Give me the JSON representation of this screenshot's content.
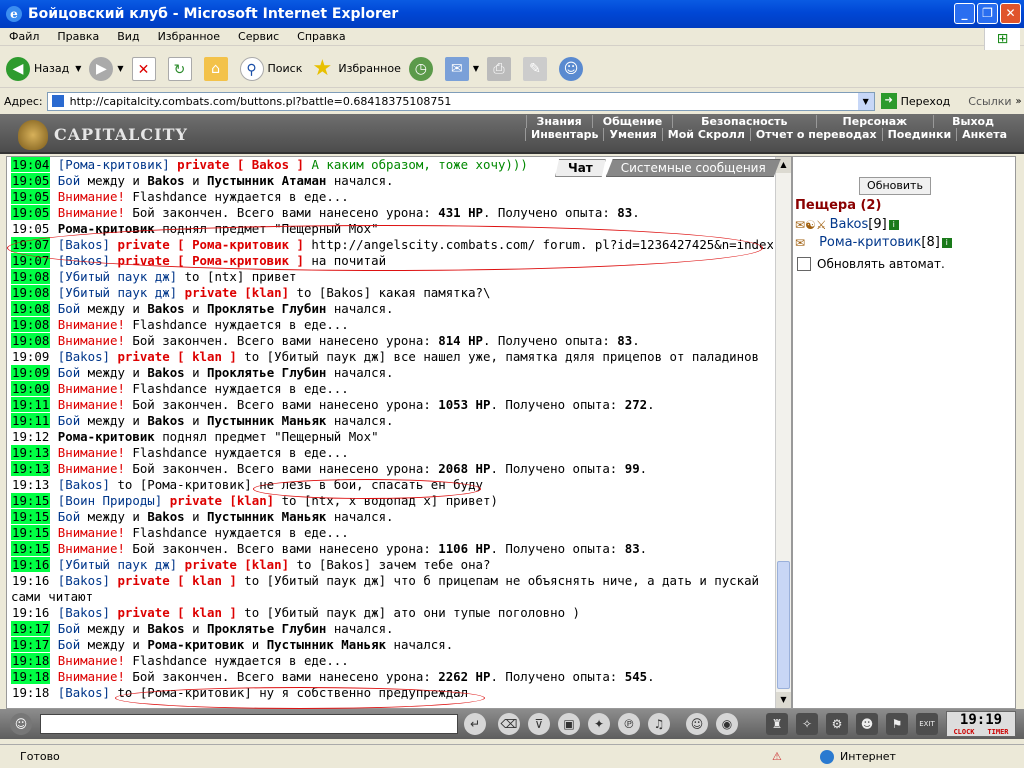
{
  "window": {
    "title": "Бойцовский клуб - Microsoft Internet Explorer"
  },
  "menu": [
    "Файл",
    "Правка",
    "Вид",
    "Избранное",
    "Сервис",
    "Справка"
  ],
  "toolbar": {
    "back": "Назад",
    "search": "Поиск",
    "favorites": "Избранное"
  },
  "address": {
    "label": "Адрес:",
    "url": "http://capitalcity.combats.com/buttons.pl?battle=0.68418375108751",
    "go": "Переход",
    "links": "Ссылки"
  },
  "game": {
    "logo": "CAPITALCITY",
    "nav1": [
      "Знания",
      "Общение",
      "Безопасность",
      "Персонаж",
      "Выход"
    ],
    "nav2": [
      "Инвентарь",
      "Умения",
      "Мой Скролл",
      "Отчет о переводах",
      "Поединки",
      "Анкета"
    ]
  },
  "tabs": {
    "chat": "Чат",
    "system": "Системные сообщения"
  },
  "chat_lines": [
    {
      "ts": "19:04",
      "hl": true,
      "parts": [
        {
          "t": "[Рома-критовик]",
          "c": "nick"
        },
        {
          "t": " "
        },
        {
          "t": "private [ Bakos ]",
          "c": "priv"
        },
        {
          "t": " А каким образом, тоже хочу)))",
          "c": "grn"
        }
      ]
    },
    {
      "ts": "19:05",
      "hl": true,
      "parts": [
        {
          "t": "Бой",
          "c": "nick"
        },
        {
          "t": " между и "
        },
        {
          "t": "Bakos",
          "c": "b"
        },
        {
          "t": " и "
        },
        {
          "t": "Пустынник Атаман",
          "c": "b"
        },
        {
          "t": " начался."
        }
      ]
    },
    {
      "ts": "19:05",
      "hl": true,
      "parts": [
        {
          "t": "Внимание!",
          "c": "warn"
        },
        {
          "t": " Flashdance нуждается в еде..."
        }
      ]
    },
    {
      "ts": "19:05",
      "hl": true,
      "parts": [
        {
          "t": "Внимание!",
          "c": "warn"
        },
        {
          "t": " Бой закончен. Всего вами нанесено урона: "
        },
        {
          "t": "431 HP",
          "c": "b"
        },
        {
          "t": ". Получено опыта: "
        },
        {
          "t": "83",
          "c": "b"
        },
        {
          "t": "."
        }
      ]
    },
    {
      "ts": "19:05",
      "hl": false,
      "parts": [
        {
          "t": "Рома-критовик",
          "c": "b"
        },
        {
          "t": " поднял предмет \"Пещерный Мох\""
        }
      ]
    },
    {
      "ts": "19:07",
      "hl": true,
      "parts": [
        {
          "t": "[Bakos]",
          "c": "nick"
        },
        {
          "t": " "
        },
        {
          "t": "private [ Рома-критовик ]",
          "c": "priv"
        },
        {
          "t": " http://angelscity.combats.com/ forum. pl?id=1236427425&n=index"
        }
      ]
    },
    {
      "ts": "19:07",
      "hl": true,
      "parts": [
        {
          "t": "[Bakos]",
          "c": "nick"
        },
        {
          "t": " "
        },
        {
          "t": "private [ Рома-критовик ]",
          "c": "priv"
        },
        {
          "t": " на почитай"
        }
      ]
    },
    {
      "ts": "19:08",
      "hl": true,
      "parts": [
        {
          "t": "[Убитый паук дж]",
          "c": "nick"
        },
        {
          "t": " to [ntx] привет"
        }
      ]
    },
    {
      "ts": "19:08",
      "hl": true,
      "parts": [
        {
          "t": "[Убитый паук дж]",
          "c": "nick"
        },
        {
          "t": " "
        },
        {
          "t": "private [klan]",
          "c": "priv"
        },
        {
          "t": " to [Bakos] какая памятка?\\"
        }
      ]
    },
    {
      "ts": "19:08",
      "hl": true,
      "parts": [
        {
          "t": "Бой",
          "c": "nick"
        },
        {
          "t": " между и "
        },
        {
          "t": "Bakos",
          "c": "b"
        },
        {
          "t": " и "
        },
        {
          "t": "Проклятье Глубин",
          "c": "b"
        },
        {
          "t": " начался."
        }
      ]
    },
    {
      "ts": "19:08",
      "hl": true,
      "parts": [
        {
          "t": "Внимание!",
          "c": "warn"
        },
        {
          "t": " Flashdance нуждается в еде..."
        }
      ]
    },
    {
      "ts": "19:08",
      "hl": true,
      "parts": [
        {
          "t": "Внимание!",
          "c": "warn"
        },
        {
          "t": " Бой закончен. Всего вами нанесено урона: "
        },
        {
          "t": "814 HP",
          "c": "b"
        },
        {
          "t": ". Получено опыта: "
        },
        {
          "t": "83",
          "c": "b"
        },
        {
          "t": "."
        }
      ]
    },
    {
      "ts": "19:09",
      "hl": false,
      "parts": [
        {
          "t": "[Bakos]",
          "c": "nick"
        },
        {
          "t": " "
        },
        {
          "t": "private [ klan ]",
          "c": "priv"
        },
        {
          "t": " to [Убитый паук дж] все нашел уже, памятка дяля прицепов от паладинов"
        }
      ]
    },
    {
      "ts": "19:09",
      "hl": true,
      "parts": [
        {
          "t": "Бой",
          "c": "nick"
        },
        {
          "t": " между и "
        },
        {
          "t": "Bakos",
          "c": "b"
        },
        {
          "t": " и "
        },
        {
          "t": "Проклятье Глубин",
          "c": "b"
        },
        {
          "t": " начался."
        }
      ]
    },
    {
      "ts": "19:09",
      "hl": true,
      "parts": [
        {
          "t": "Внимание!",
          "c": "warn"
        },
        {
          "t": " Flashdance нуждается в еде..."
        }
      ]
    },
    {
      "ts": "19:11",
      "hl": true,
      "parts": [
        {
          "t": "Внимание!",
          "c": "warn"
        },
        {
          "t": " Бой закончен. Всего вами нанесено урона: "
        },
        {
          "t": "1053 HP",
          "c": "b"
        },
        {
          "t": ". Получено опыта: "
        },
        {
          "t": "272",
          "c": "b"
        },
        {
          "t": "."
        }
      ]
    },
    {
      "ts": "19:11",
      "hl": true,
      "parts": [
        {
          "t": "Бой",
          "c": "nick"
        },
        {
          "t": " между и "
        },
        {
          "t": "Bakos",
          "c": "b"
        },
        {
          "t": " и "
        },
        {
          "t": "Пустынник Маньяк",
          "c": "b"
        },
        {
          "t": " начался."
        }
      ]
    },
    {
      "ts": "19:12",
      "hl": false,
      "parts": [
        {
          "t": "Рома-критовик",
          "c": "b"
        },
        {
          "t": " поднял предмет \"Пещерный Мох\""
        }
      ]
    },
    {
      "ts": "19:13",
      "hl": true,
      "parts": [
        {
          "t": "Внимание!",
          "c": "warn"
        },
        {
          "t": " Flashdance нуждается в еде..."
        }
      ]
    },
    {
      "ts": "19:13",
      "hl": true,
      "parts": [
        {
          "t": "Внимание!",
          "c": "warn"
        },
        {
          "t": " Бой закончен. Всего вами нанесено урона: "
        },
        {
          "t": "2068 HP",
          "c": "b"
        },
        {
          "t": ". Получено опыта: "
        },
        {
          "t": "99",
          "c": "b"
        },
        {
          "t": "."
        }
      ]
    },
    {
      "ts": "19:13",
      "hl": false,
      "parts": [
        {
          "t": "[Bakos]",
          "c": "nick"
        },
        {
          "t": " to [Рома-критовик] не лезь в бои, спасать ен буду"
        }
      ]
    },
    {
      "ts": "19:15",
      "hl": true,
      "parts": [
        {
          "t": "[Воин Природы]",
          "c": "nick"
        },
        {
          "t": " "
        },
        {
          "t": "private [klan]",
          "c": "priv"
        },
        {
          "t": " to [ntx, x водопад x] привет)"
        }
      ]
    },
    {
      "ts": "19:15",
      "hl": true,
      "parts": [
        {
          "t": "Бой",
          "c": "nick"
        },
        {
          "t": " между и "
        },
        {
          "t": "Bakos",
          "c": "b"
        },
        {
          "t": " и "
        },
        {
          "t": "Пустынник Маньяк",
          "c": "b"
        },
        {
          "t": " начался."
        }
      ]
    },
    {
      "ts": "19:15",
      "hl": true,
      "parts": [
        {
          "t": "Внимание!",
          "c": "warn"
        },
        {
          "t": " Flashdance нуждается в еде..."
        }
      ]
    },
    {
      "ts": "19:15",
      "hl": true,
      "parts": [
        {
          "t": "Внимание!",
          "c": "warn"
        },
        {
          "t": " Бой закончен. Всего вами нанесено урона: "
        },
        {
          "t": "1106 HP",
          "c": "b"
        },
        {
          "t": ". Получено опыта: "
        },
        {
          "t": "83",
          "c": "b"
        },
        {
          "t": "."
        }
      ]
    },
    {
      "ts": "19:16",
      "hl": true,
      "parts": [
        {
          "t": "[Убитый паук дж]",
          "c": "nick"
        },
        {
          "t": " "
        },
        {
          "t": "private [klan]",
          "c": "priv"
        },
        {
          "t": " to [Bakos] зачем тебе она?"
        }
      ]
    },
    {
      "ts": "19:16",
      "hl": false,
      "wrap": true,
      "parts": [
        {
          "t": "[Bakos]",
          "c": "nick"
        },
        {
          "t": " "
        },
        {
          "t": "private [ klan ]",
          "c": "priv"
        },
        {
          "t": " to [Убитый паук дж] что б прицепам не объяснять ниче, а дать и пускай сами читают"
        }
      ]
    },
    {
      "ts": "19:16",
      "hl": false,
      "parts": [
        {
          "t": "[Bakos]",
          "c": "nick"
        },
        {
          "t": " "
        },
        {
          "t": "private [ klan ]",
          "c": "priv"
        },
        {
          "t": " to [Убитый паук дж] ато они тупые поголовно )"
        }
      ]
    },
    {
      "ts": "19:17",
      "hl": true,
      "parts": [
        {
          "t": "Бой",
          "c": "nick"
        },
        {
          "t": " между и "
        },
        {
          "t": "Bakos",
          "c": "b"
        },
        {
          "t": " и "
        },
        {
          "t": "Проклятье Глубин",
          "c": "b"
        },
        {
          "t": " начался."
        }
      ]
    },
    {
      "ts": "19:17",
      "hl": true,
      "parts": [
        {
          "t": "Бой",
          "c": "nick"
        },
        {
          "t": " между и "
        },
        {
          "t": "Рома-критовик",
          "c": "b"
        },
        {
          "t": " и "
        },
        {
          "t": "Пустынник Маньяк",
          "c": "b"
        },
        {
          "t": " начался."
        }
      ]
    },
    {
      "ts": "19:18",
      "hl": true,
      "parts": [
        {
          "t": "Внимание!",
          "c": "warn"
        },
        {
          "t": " Flashdance нуждается в еде..."
        }
      ]
    },
    {
      "ts": "19:18",
      "hl": true,
      "parts": [
        {
          "t": "Внимание!",
          "c": "warn"
        },
        {
          "t": " Бой закончен. Всего вами нанесено урона: "
        },
        {
          "t": "2262 HP",
          "c": "b"
        },
        {
          "t": ". Получено опыта: "
        },
        {
          "t": "545",
          "c": "b"
        },
        {
          "t": "."
        }
      ]
    },
    {
      "ts": "19:18",
      "hl": false,
      "parts": [
        {
          "t": "[Bakos]",
          "c": "nick"
        },
        {
          "t": " to [Рома-критовик] ну я собственно предупреждал"
        }
      ]
    }
  ],
  "sidebar": {
    "refresh": "Обновить",
    "location": "Пещера (2)",
    "users": [
      {
        "name": "Bakos",
        "level": "[9]"
      },
      {
        "name": "Рома-критовик",
        "level": "[8]"
      }
    ],
    "auto_refresh": "Обновлять автомат."
  },
  "clock": {
    "time": "19:19",
    "label_clock": "CLOCK",
    "label_timer": "TIMER"
  },
  "status": {
    "text": "Готово",
    "zone": "Интернет"
  }
}
